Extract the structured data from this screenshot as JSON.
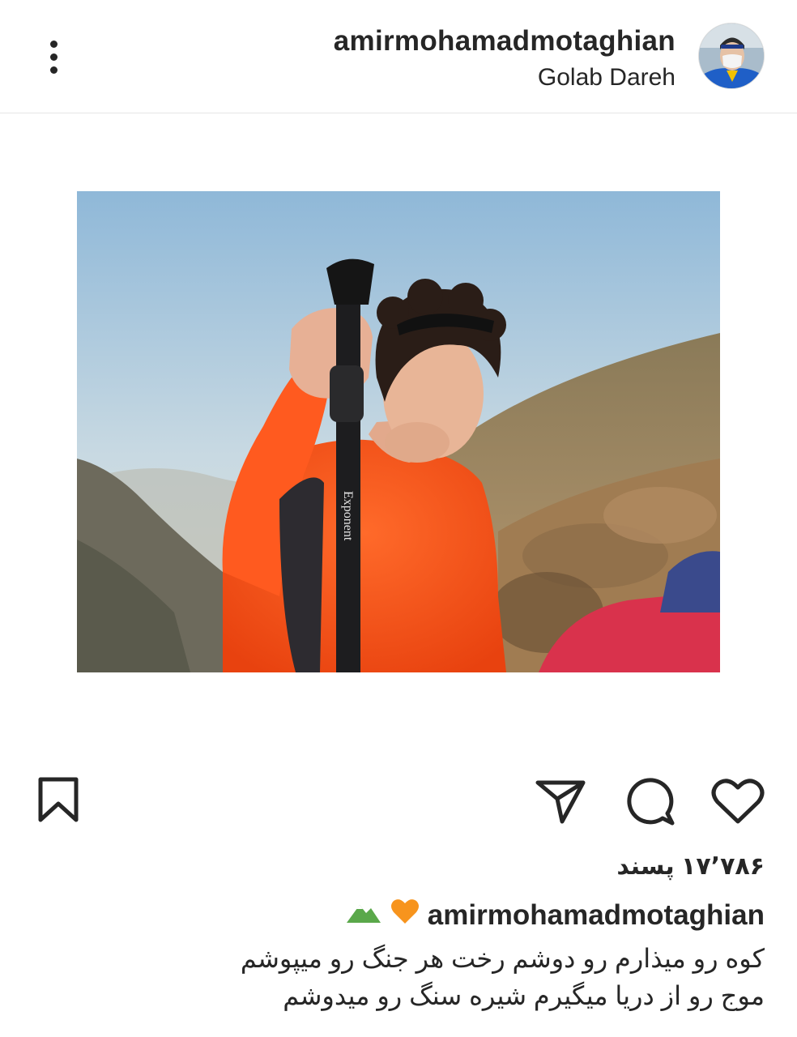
{
  "header": {
    "username": "amirmohamadmotaghian",
    "location": "Golab Dareh",
    "more_icon": "more-vertical-icon",
    "avatar_icon": "profile-avatar"
  },
  "post": {
    "image_alt": "",
    "pole_brand": "Exponent"
  },
  "actions": {
    "like_icon": "heart-icon",
    "comment_icon": "comment-bubble-icon",
    "share_icon": "paper-plane-icon",
    "save_icon": "bookmark-icon"
  },
  "likes": {
    "count": "۱۷٬۷۸۶",
    "label": "پسند"
  },
  "caption": {
    "username": "amirmohamadmotaghian",
    "emojis": [
      "orange-heart-icon",
      "mountain-icon"
    ],
    "lines": [
      "کوه رو میذارم رو دوشم رخت هر جنگ رو میپوشم",
      "موج رو از دریا میگیرم شیره سنگ رو میدوشم"
    ]
  },
  "colors": {
    "text": "#262626",
    "divider": "#e6e6e6",
    "shirt": "#ff5a1f",
    "sky": "#a8c7dd"
  }
}
